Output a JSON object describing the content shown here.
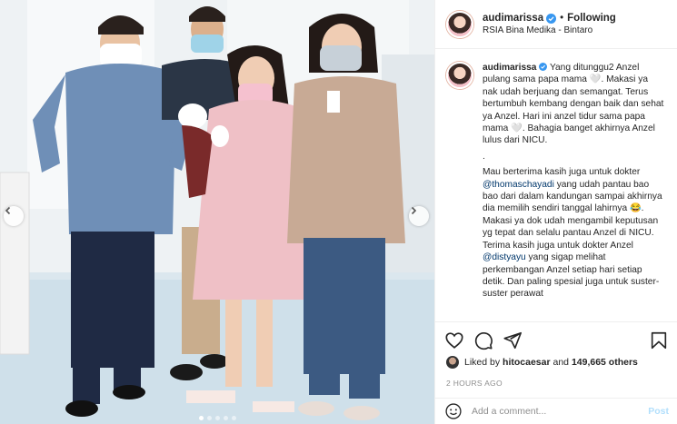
{
  "post": {
    "author": "audimarissa",
    "follow_state": "Following",
    "location": "RSIA Bina Medika - Bintaro",
    "header_separator": "•"
  },
  "caption": {
    "username": "audimarissa",
    "paragraph1": "Yang ditunggu2 Anzel pulang sama papa mama 🤍. Makasi ya nak udah berjuang dan semangat. Terus bertumbuh kembang dengan baik dan sehat ya Anzel. Hari ini anzel tidur sama papa mama 🤍. Bahagia banget akhirnya Anzel lulus dari NICU.",
    "dot_line": ".",
    "p2_before": "Mau berterima kasih juga untuk dokter ",
    "mention1": "@thomaschayadi",
    "p2_middle": " yang udah pantau bao bao dari dalam kandungan sampai akhirnya dia memilih sendiri tanggal lahirnya 😂. Makasi ya dok udah mengambil keputusan yg tepat dan selalu pantau Anzel di NICU. Terima kasih juga untuk dokter Anzel ",
    "mention2": "@distyayu",
    "p2_after": " yang sigap melihat perkembangan Anzel setiap hari setiap detik. Dan paling spesial juga untuk suster-suster perawat"
  },
  "likes": {
    "prefix": "Liked by",
    "user": "hitocaesar",
    "conjunction": "and",
    "count_text": "149,665 others"
  },
  "timestamp": "2 HOURS AGO",
  "comment": {
    "placeholder": "Add a comment...",
    "post_label": "Post"
  },
  "carousel": {
    "slides": 5,
    "active_index": 0
  },
  "colors": {
    "verified_blue": "#3897f0",
    "mention_blue": "#00376b",
    "post_button_disabled": "#b2dffc",
    "muted_gray": "#8e8e8e"
  },
  "icons": [
    "verified-icon",
    "heart-icon",
    "comment-icon",
    "share-icon",
    "bookmark-icon",
    "emoji-icon",
    "chevron-left-icon",
    "chevron-right-icon"
  ]
}
